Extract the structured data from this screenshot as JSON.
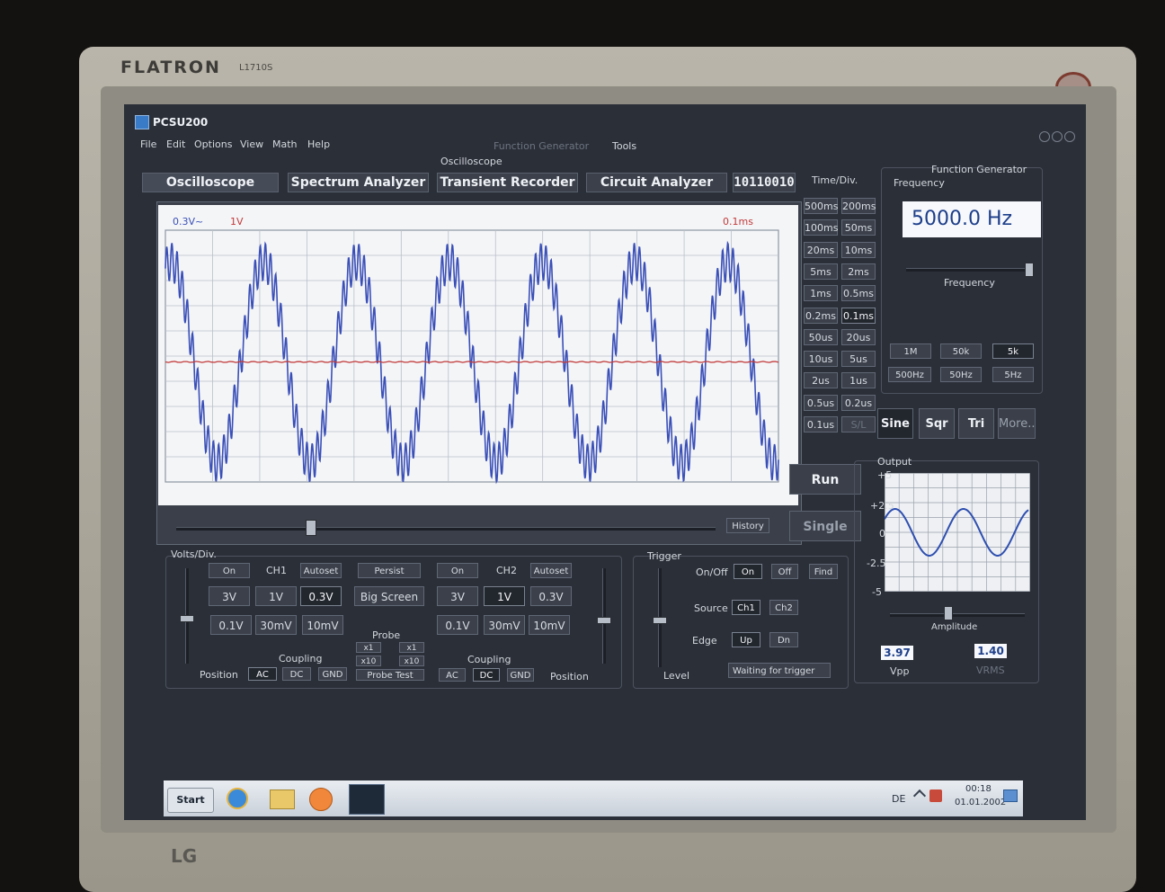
{
  "monitor": {
    "brand": "FLATRON",
    "model": "L1710S",
    "maker": "LG"
  },
  "window": {
    "title": "PCSU200"
  },
  "menu": [
    "File",
    "Edit",
    "Options",
    "View",
    "Math",
    "Help"
  ],
  "menu_right": {
    "function_generator": "Function Generator",
    "tools": "Tools"
  },
  "section_label": "Oscilloscope",
  "tabs": [
    "Oscilloscope",
    "Spectrum Analyzer",
    "Transient Recorder",
    "Circuit Analyzer"
  ],
  "digital_readout": "10110010",
  "scope": {
    "ch1_scale": "0.3V~",
    "ch2_scale": "1V",
    "timebase": "0.1ms",
    "history_label": "History",
    "colors": {
      "ch1": "#3a4fb8",
      "ch2": "#c23a3a",
      "grid": "#b9bfc9",
      "background": "#f4f5f7"
    }
  },
  "timediv": {
    "title": "Time/Div.",
    "buttons": [
      [
        "500ms",
        "200ms"
      ],
      [
        "100ms",
        "50ms"
      ],
      [
        "20ms",
        "10ms"
      ],
      [
        "5ms",
        "2ms"
      ],
      [
        "1ms",
        "0.5ms"
      ],
      [
        "0.2ms",
        "0.1ms"
      ],
      [
        "50us",
        "20us"
      ],
      [
        "10us",
        "5us"
      ],
      [
        "2us",
        "1us"
      ],
      [
        "0.5us",
        "0.2us"
      ],
      [
        "0.1us",
        "S/L"
      ]
    ],
    "selected": "0.1ms"
  },
  "run_label": "Run",
  "single_label": "Single",
  "volts": {
    "title": "Volts/Div.",
    "ch1": {
      "on": "On",
      "name": "CH1",
      "autoset": "Autoset",
      "ranges": [
        "3V",
        "1V",
        "0.3V",
        "0.1V",
        "30mV",
        "10mV"
      ],
      "selected": "0.3V",
      "coupling": [
        "AC",
        "DC",
        "GND"
      ],
      "coupling_selected": "AC"
    },
    "ch2": {
      "on": "On",
      "name": "CH2",
      "autoset": "Autoset",
      "ranges": [
        "3V",
        "1V",
        "0.3V",
        "0.1V",
        "30mV",
        "10mV"
      ],
      "selected": "1V",
      "coupling": [
        "AC",
        "DC",
        "GND"
      ],
      "coupling_selected": "DC"
    },
    "persist": "Persist",
    "big_screen": "Big Screen",
    "probe": "Probe",
    "x1": "x1",
    "x10": "x10",
    "probe_test": "Probe Test",
    "coupling": "Coupling",
    "position": "Position"
  },
  "trigger": {
    "title": "Trigger",
    "onoff": "On/Off",
    "on": "On",
    "off": "Off",
    "find": "Find",
    "source": "Source",
    "ch1": "Ch1",
    "ch2": "Ch2",
    "edge": "Edge",
    "up": "Up",
    "dn": "Dn",
    "level": "Level",
    "status": "Waiting for trigger"
  },
  "funcgen": {
    "title": "Function Generator",
    "freq_label": "Frequency",
    "freq_value": "5000.0 Hz",
    "freq_slider_label": "Frequency",
    "ranges_row1": [
      "1M",
      "50k",
      "5k"
    ],
    "ranges_row2": [
      "500Hz",
      "50Hz",
      "5Hz"
    ],
    "waves": [
      "Sine",
      "Sqr",
      "Tri",
      "More.."
    ],
    "output_label": "Output",
    "yticks": [
      "+5",
      "+2.5",
      "0",
      "-2.5",
      "-5"
    ],
    "amplitude_label": "Amplitude",
    "vpp_value": "3.97",
    "vpp_label": "Vpp",
    "vrms_value": "1.40",
    "vrms_label": "VRMS"
  },
  "taskbar": {
    "start": "Start",
    "lang": "DE",
    "time": "00:18",
    "date": "01.01.2002"
  }
}
